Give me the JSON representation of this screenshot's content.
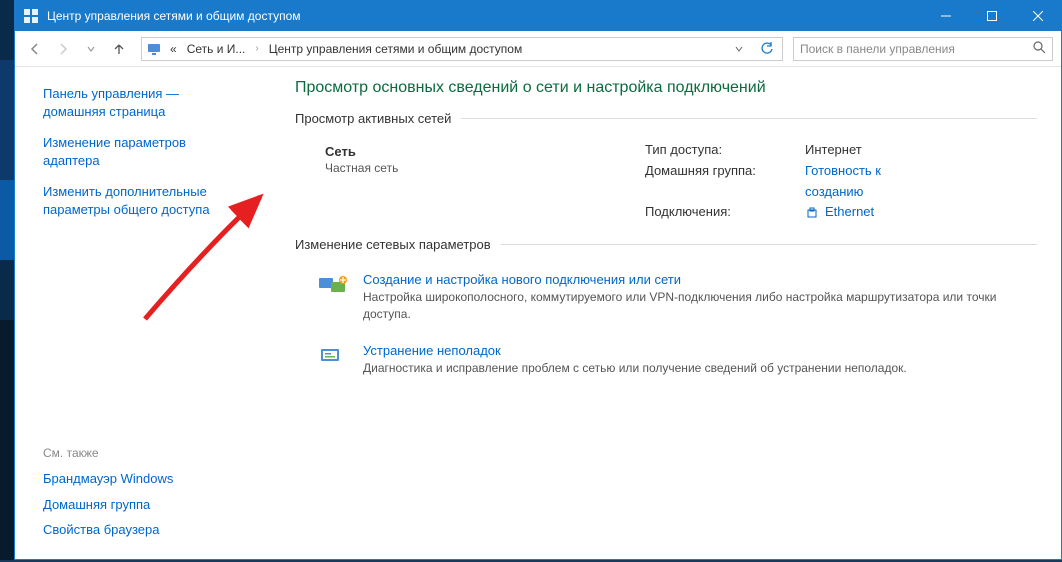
{
  "window": {
    "title": "Центр управления сетями и общим доступом"
  },
  "breadcrumb": {
    "seg1_prefix": "«",
    "seg1": "Сеть и И...",
    "seg2": "Центр управления сетями и общим доступом"
  },
  "search": {
    "placeholder": "Поиск в панели управления"
  },
  "sidebar": {
    "links": [
      {
        "l1": "Панель управления —",
        "l2": "домашняя страница"
      },
      {
        "l1": "Изменение параметров",
        "l2": "адаптера"
      },
      {
        "l1": "Изменить дополнительные",
        "l2": "параметры общего доступа"
      }
    ],
    "see_also_label": "См. также",
    "also": [
      "Брандмауэр Windows",
      "Домашняя группа",
      "Свойства браузера"
    ]
  },
  "content": {
    "page_title": "Просмотр основных сведений о сети и настройка подключений",
    "active_networks_label": "Просмотр активных сетей",
    "network": {
      "name": "Сеть",
      "subtitle": "Частная сеть",
      "rows": {
        "access_type_label": "Тип доступа:",
        "access_type_value": "Интернет",
        "homegroup_label": "Домашняя группа:",
        "homegroup_value_l1": "Готовность к",
        "homegroup_value_l2": "созданию",
        "connections_label": "Подключения:",
        "connections_value": "Ethernet"
      }
    },
    "change_settings_label": "Изменение сетевых параметров",
    "actions": [
      {
        "title": "Создание и настройка нового подключения или сети",
        "desc": "Настройка широкополосного, коммутируемого или VPN-подключения либо настройка маршрутизатора или точки доступа."
      },
      {
        "title": "Устранение неполадок",
        "desc": "Диагностика и исправление проблем с сетью или получение сведений об устранении неполадок."
      }
    ]
  }
}
